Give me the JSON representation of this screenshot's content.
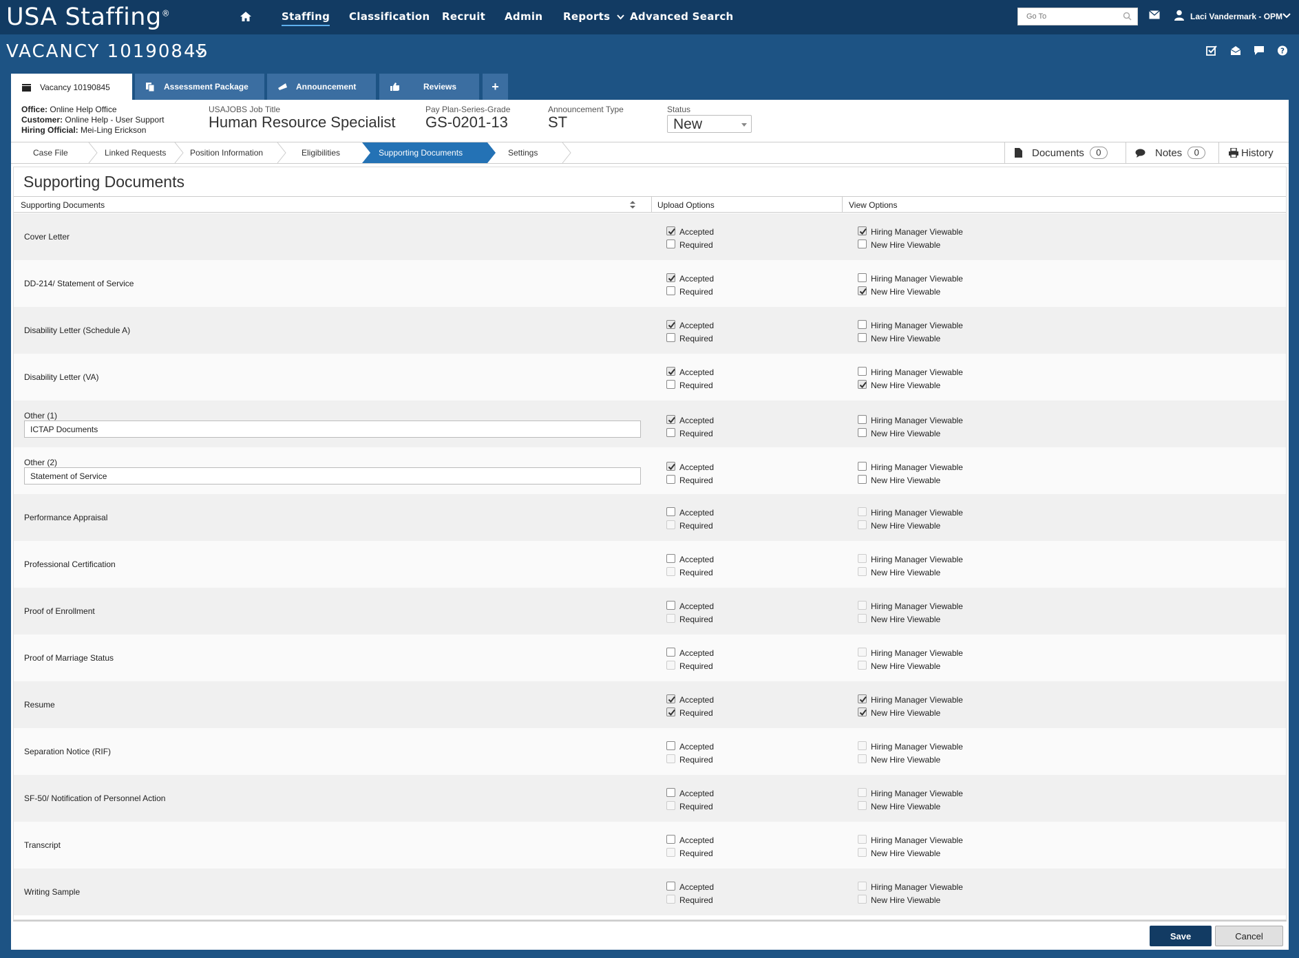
{
  "app": {
    "brand": "USA Staffing",
    "brand_mark": "®",
    "nav": {
      "staffing": "Staffing",
      "classification": "Classification",
      "recruit": "Recruit",
      "admin": "Admin",
      "reports": "Reports",
      "advanced_search": "Advanced Search"
    },
    "goto_placeholder": "Go To",
    "user_name": "Laci Vandermark - OPM"
  },
  "vacancy": {
    "title": "VACANCY 10190845",
    "tabs": {
      "vacancy": "Vacancy 10190845",
      "assessment": "Assessment Package",
      "announcement": "Announcement",
      "reviews": "Reviews",
      "plus": "+"
    },
    "office_label": "Office:",
    "office_value": "Online Help Office",
    "customer_label": "Customer:",
    "customer_value": "Online Help - User Support",
    "hiring_label": "Hiring Official:",
    "hiring_value": "Mei-Ling Erickson",
    "job_title_label": "USAJOBS Job Title",
    "job_title_value": "Human Resource Specialist",
    "pay_plan_label": "Pay Plan-Series-Grade",
    "pay_plan_value": "GS-0201-13",
    "ann_type_label": "Announcement Type",
    "ann_type_value": "ST",
    "status_label": "Status",
    "status_value": "New"
  },
  "steps": {
    "case_file": "Case File",
    "linked_requests": "Linked Requests",
    "position_information": "Position Information",
    "eligibilities": "Eligibilities",
    "supporting_documents": "Supporting Documents",
    "settings": "Settings"
  },
  "tools": {
    "documents": "Documents",
    "documents_count": "0",
    "notes": "Notes",
    "notes_count": "0",
    "history": "History"
  },
  "section": {
    "title": "Supporting Documents",
    "col_docs": "Supporting Documents",
    "col_upload": "Upload Options",
    "col_view": "View Options",
    "lbl_accepted": "Accepted",
    "lbl_required": "Required",
    "lbl_hm": "Hiring Manager Viewable",
    "lbl_nh": "New Hire Viewable"
  },
  "rows": [
    {
      "name": "Cover Letter",
      "accepted": true,
      "required": false,
      "hm": true,
      "nh": false,
      "dis": false
    },
    {
      "name": "DD-214/ Statement of Service",
      "accepted": true,
      "required": false,
      "hm": false,
      "nh": true,
      "dis": false
    },
    {
      "name": "Disability Letter (Schedule A)",
      "accepted": true,
      "required": false,
      "hm": false,
      "nh": false,
      "dis": false
    },
    {
      "name": "Disability Letter (VA)",
      "accepted": true,
      "required": false,
      "hm": false,
      "nh": true,
      "dis": false
    },
    {
      "name": "Other (1)",
      "input": "ICTAP Documents",
      "accepted": true,
      "required": false,
      "hm": false,
      "nh": false,
      "dis": false
    },
    {
      "name": "Other (2)",
      "input": "Statement of Service",
      "accepted": true,
      "required": false,
      "hm": false,
      "nh": false,
      "dis": false
    },
    {
      "name": "Performance Appraisal",
      "accepted": false,
      "required": false,
      "hm": false,
      "nh": false,
      "dis": true
    },
    {
      "name": "Professional Certification",
      "accepted": false,
      "required": false,
      "hm": false,
      "nh": false,
      "dis": true
    },
    {
      "name": "Proof of Enrollment",
      "accepted": false,
      "required": false,
      "hm": false,
      "nh": false,
      "dis": true
    },
    {
      "name": "Proof of Marriage Status",
      "accepted": false,
      "required": false,
      "hm": false,
      "nh": false,
      "dis": true
    },
    {
      "name": "Resume",
      "accepted": true,
      "required": true,
      "hm": true,
      "nh": true,
      "dis": false
    },
    {
      "name": "Separation Notice (RIF)",
      "accepted": false,
      "required": false,
      "hm": false,
      "nh": false,
      "dis": true
    },
    {
      "name": "SF-50/ Notification of Personnel Action",
      "accepted": false,
      "required": false,
      "hm": false,
      "nh": false,
      "dis": true
    },
    {
      "name": "Transcript",
      "accepted": false,
      "required": false,
      "hm": false,
      "nh": false,
      "dis": true
    },
    {
      "name": "Writing Sample",
      "accepted": false,
      "required": false,
      "hm": false,
      "nh": false,
      "dis": true
    }
  ],
  "buttons": {
    "save": "Save",
    "cancel": "Cancel"
  }
}
